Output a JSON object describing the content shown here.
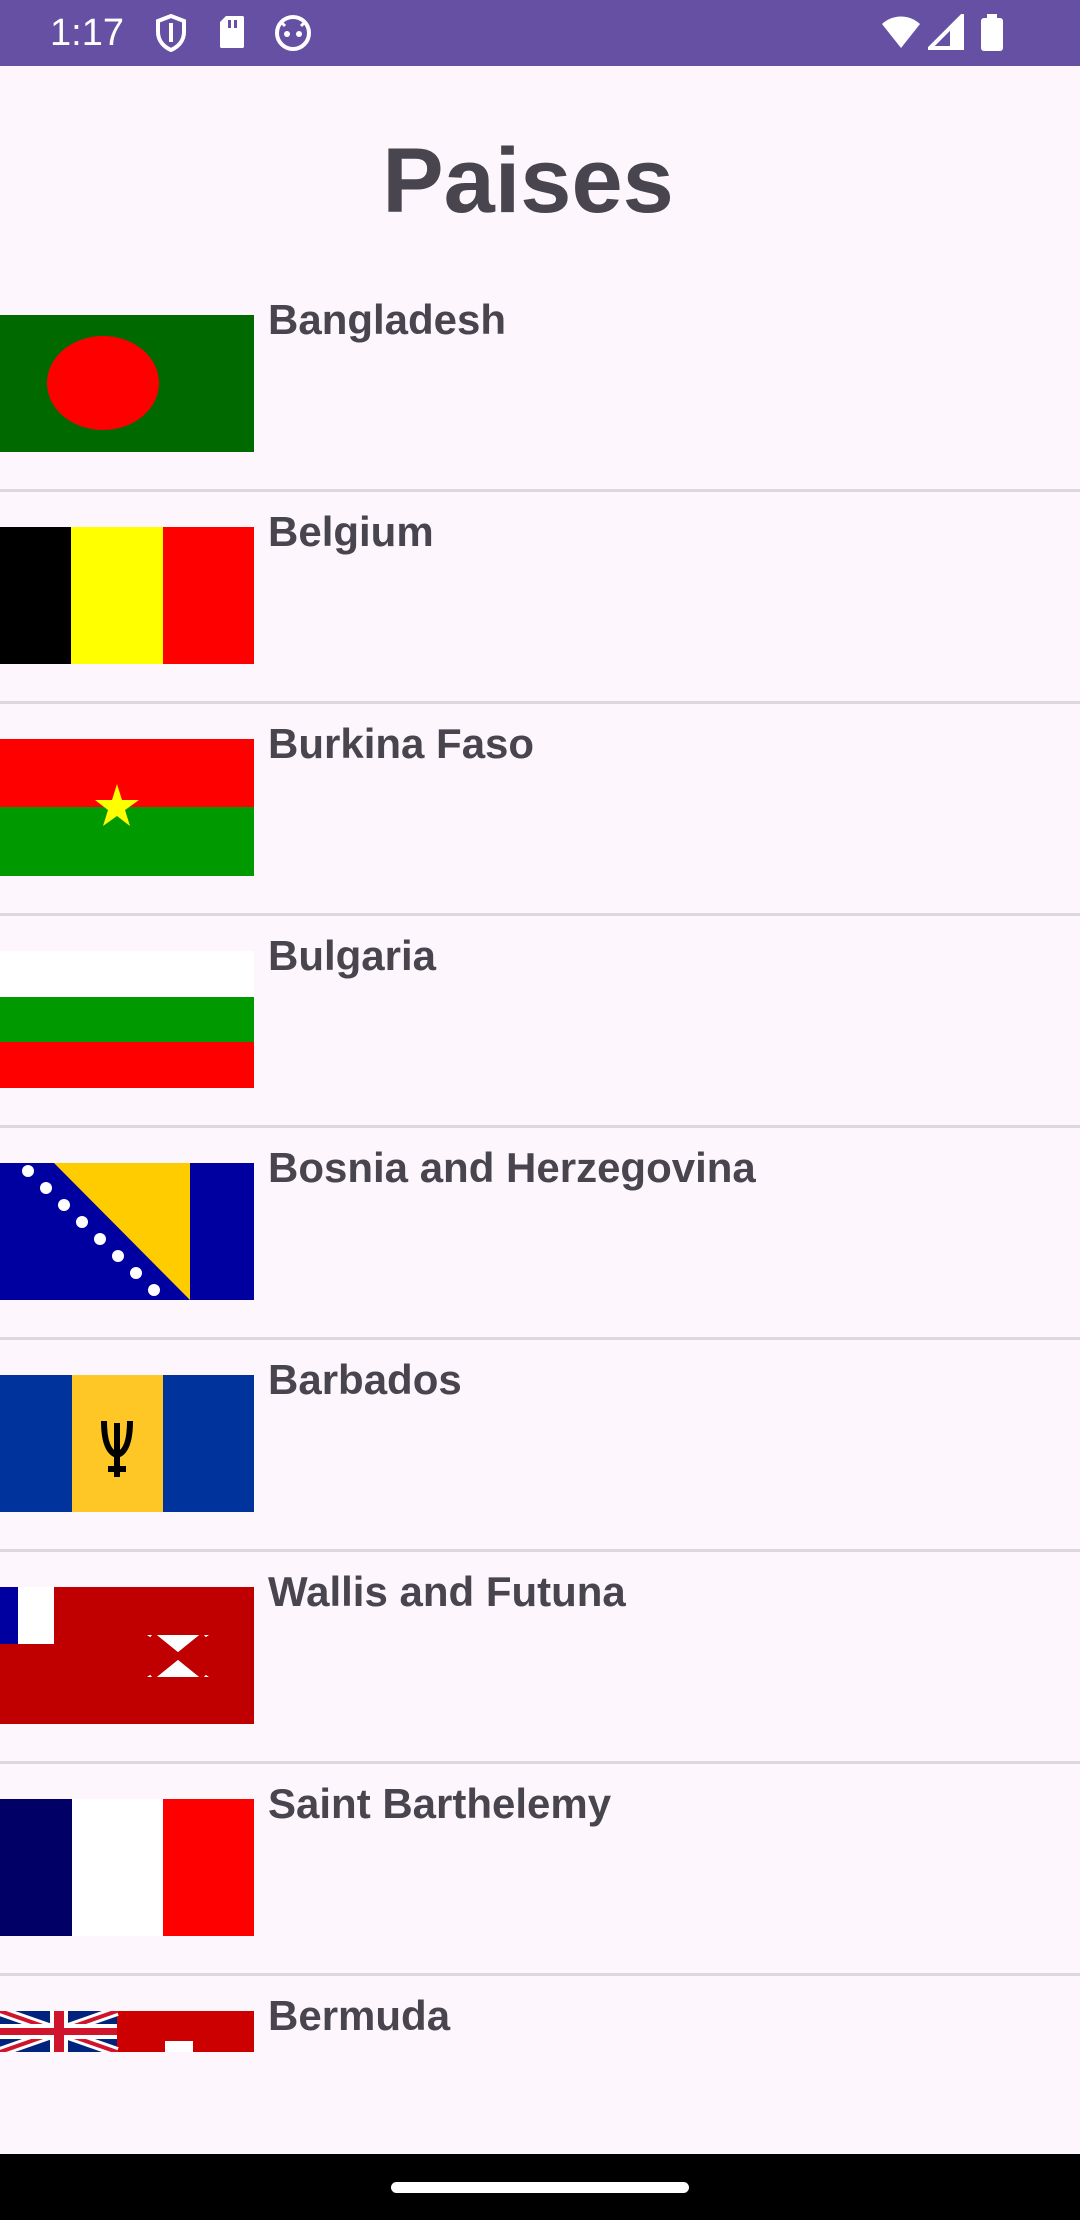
{
  "status_bar": {
    "time": "1:17",
    "icons": [
      "shield-icon",
      "sd-card-icon",
      "android-icon",
      "wifi-icon",
      "signal-icon",
      "battery-icon"
    ],
    "background": "#6650a4"
  },
  "header": {
    "title": "Paises"
  },
  "countries": [
    {
      "name": "Bangladesh",
      "flag": "bangladesh-flag"
    },
    {
      "name": "Belgium",
      "flag": "belgium-flag"
    },
    {
      "name": "Burkina Faso",
      "flag": "burkina-faso-flag"
    },
    {
      "name": "Bulgaria",
      "flag": "bulgaria-flag"
    },
    {
      "name": "Bosnia and Herzegovina",
      "flag": "bosnia-flag"
    },
    {
      "name": "Barbados",
      "flag": "barbados-flag"
    },
    {
      "name": "Wallis and Futuna",
      "flag": "wallis-futuna-flag"
    },
    {
      "name": "Saint Barthelemy",
      "flag": "saint-barthelemy-flag"
    },
    {
      "name": "Bermuda",
      "flag": "bermuda-flag"
    }
  ],
  "colors": {
    "background": "#fdf6fd",
    "text": "#48454f",
    "divider": "#dcd8dd"
  }
}
